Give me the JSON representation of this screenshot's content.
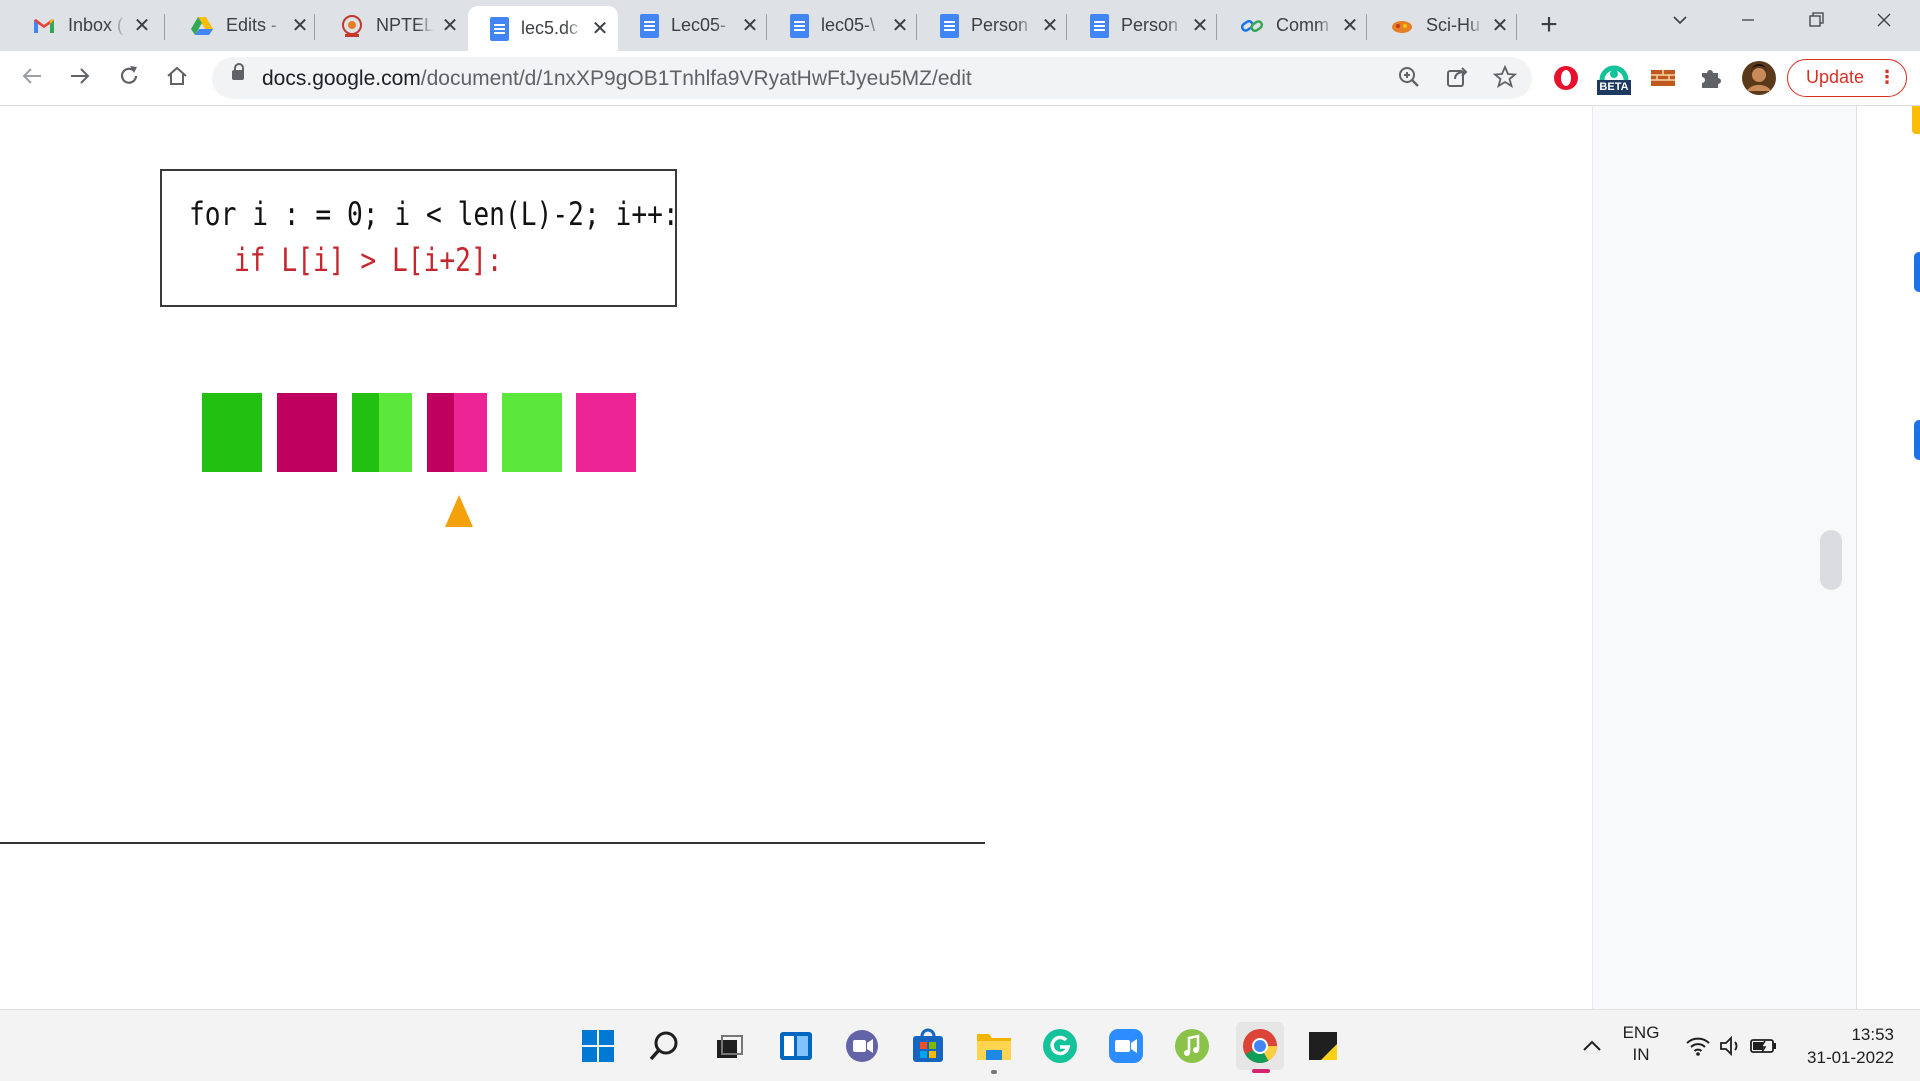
{
  "browser": {
    "tabs": [
      {
        "title": "Inbox (",
        "icon": "gmail-icon"
      },
      {
        "title": "Edits -",
        "icon": "google-drive-icon"
      },
      {
        "title": "NPTEL",
        "icon": "nptel-icon"
      },
      {
        "title": "lec5.dc",
        "icon": "google-docs-icon",
        "active": true
      },
      {
        "title": "Lec05-",
        "icon": "google-docs-icon"
      },
      {
        "title": "lec05-\\",
        "icon": "google-docs-icon"
      },
      {
        "title": "Person",
        "icon": "google-docs-icon"
      },
      {
        "title": "Person",
        "icon": "google-docs-icon"
      },
      {
        "title": "Comm",
        "icon": "link-icon"
      },
      {
        "title": "Sci-Hu",
        "icon": "sci-hub-icon"
      }
    ],
    "close_glyph": "✕",
    "new_tab_glyph": "+",
    "url_host": "docs.google.com",
    "url_path": "/document/d/1nxXP9gOB1Tnhlfa9VRyatHwFtJyeu5MZ/edit",
    "update_label": "Update",
    "update_dots": "⋮",
    "beta_badge": "BETA"
  },
  "content": {
    "code_line_1": "for i : = 0; i < len(L)-2; i++:",
    "code_line_2": "if L[i] > L[i+2]:",
    "code_line_1_color": "#111111",
    "code_line_2_color": "#c6262e",
    "squares": [
      {
        "name": "square-1",
        "colors": [
          "#22c010"
        ]
      },
      {
        "name": "square-2",
        "colors": [
          "#c0005e"
        ]
      },
      {
        "name": "square-3",
        "colors": [
          "#22c010",
          "#5ce83a"
        ]
      },
      {
        "name": "square-4",
        "colors": [
          "#c0005e",
          "#ec2494"
        ]
      },
      {
        "name": "square-5",
        "colors": [
          "#5ce83a"
        ]
      },
      {
        "name": "square-6",
        "colors": [
          "#ec2494"
        ]
      }
    ],
    "pointer_color": "#f4a20c"
  },
  "taskbar": {
    "apps": [
      "windows-start-icon",
      "search-icon",
      "task-view-icon",
      "widgets-icon",
      "teams-chat-icon",
      "microsoft-store-icon",
      "file-explorer-icon",
      "grammarly-icon",
      "zoom-icon",
      "music-app-icon",
      "chrome-icon",
      "sticky-notes-icon"
    ],
    "language_top": "ENG",
    "language_bottom": "IN",
    "time": "13:53",
    "date": "31-01-2022",
    "chevron": "^"
  }
}
